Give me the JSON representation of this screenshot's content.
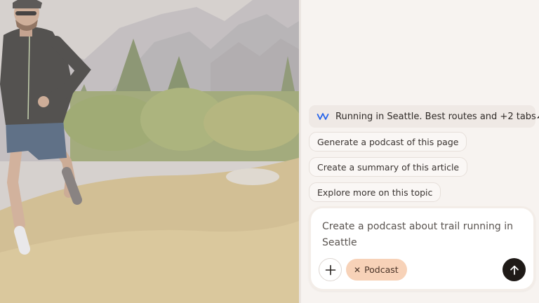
{
  "context": {
    "label": "Running in Seattle. Best routes and +2 tabs",
    "icon": "wave-logo-icon",
    "toggle_icon": "chevron-up-icon"
  },
  "suggestions": [
    {
      "label": "Generate a podcast of this page"
    },
    {
      "label": "Create a summary of this article"
    },
    {
      "label": "Explore more on this topic"
    }
  ],
  "composer": {
    "prompt_text": "Create a podcast about trail running in Seattle",
    "add_icon": "plus-icon",
    "chip": {
      "remove_glyph": "✕",
      "label": "Podcast"
    },
    "send_icon": "arrow-up-icon"
  },
  "colors": {
    "accent_chip": "#f7d2b8",
    "send_button": "#1f1a17",
    "logo_blue": "#2563eb",
    "panel_bg": "#f7f3f0"
  },
  "photo": {
    "subject": "trail-runner-photo"
  }
}
